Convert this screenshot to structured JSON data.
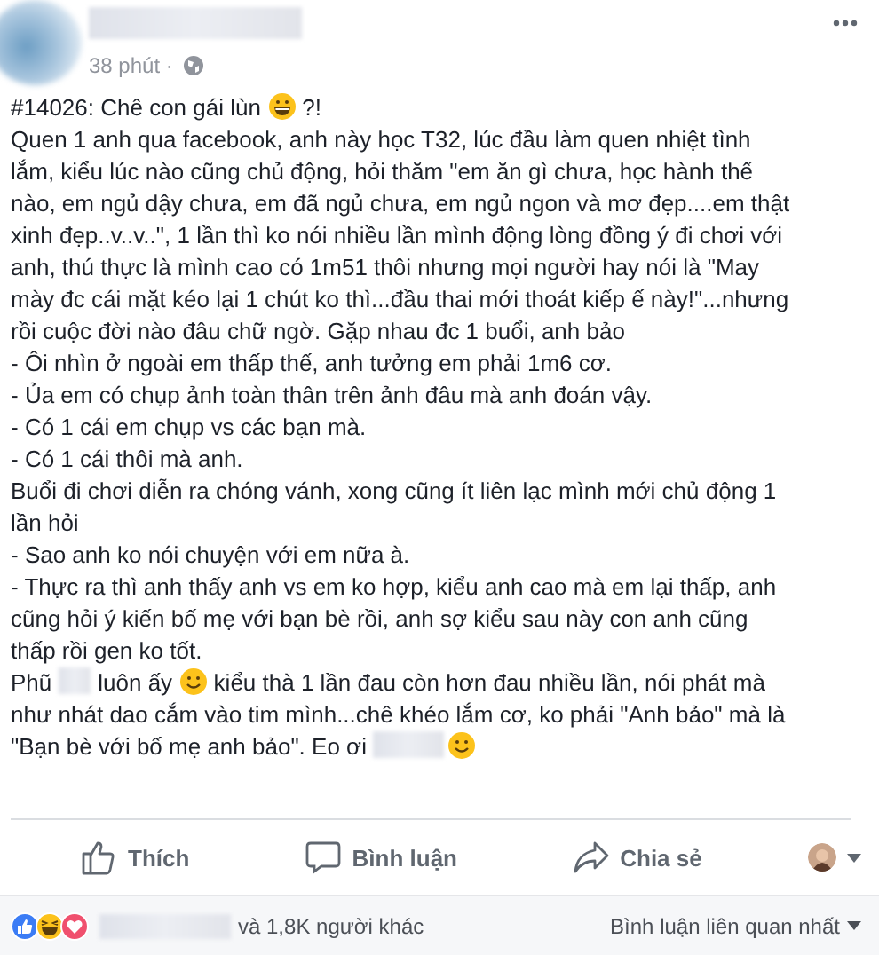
{
  "post": {
    "time": "38 phút",
    "separator": "·",
    "lines": [
      [
        {
          "kind": "text",
          "text": "#14026: Chê con gái lùn "
        },
        {
          "kind": "grin-emoji"
        },
        {
          "kind": "text",
          "text": " ?!"
        }
      ],
      [
        {
          "kind": "text",
          "text": "Quen 1 anh qua facebook, anh này học T32, lúc đầu làm quen nhiệt tình"
        }
      ],
      [
        {
          "kind": "text",
          "text": "lắm, kiểu lúc nào cũng chủ động, hỏi thăm \"em ăn gì chưa, học hành thế"
        }
      ],
      [
        {
          "kind": "text",
          "text": "nào, em ngủ dậy chưa, em đã ngủ chưa, em ngủ ngon và mơ đẹp....em thật"
        }
      ],
      [
        {
          "kind": "text",
          "text": "xinh đẹp..v..v..\", 1 lần thì ko nói nhiều lần mình động lòng đồng ý đi chơi với"
        }
      ],
      [
        {
          "kind": "text",
          "text": "anh, thú thực là mình cao có 1m51 thôi nhưng mọi người hay nói là \"May"
        }
      ],
      [
        {
          "kind": "text",
          "text": "mày đc cái mặt kéo lại 1 chút ko thì...đầu thai mới thoát kiếp ế này!\"...nhưng"
        }
      ],
      [
        {
          "kind": "text",
          "text": "rồi cuộc đời nào đâu chữ ngờ. Gặp nhau đc 1 buổi, anh bảo"
        }
      ],
      [
        {
          "kind": "text",
          "text": "- Ôi nhìn ở ngoài em thấp thế, anh tưởng em phải 1m6 cơ."
        }
      ],
      [
        {
          "kind": "text",
          "text": "- Ủa em có chụp ảnh toàn thân trên ảnh đâu mà anh đoán vậy."
        }
      ],
      [
        {
          "kind": "text",
          "text": "- Có 1 cái em chụp vs các bạn mà."
        }
      ],
      [
        {
          "kind": "text",
          "text": "- Có 1 cái thôi mà anh."
        }
      ],
      [
        {
          "kind": "text",
          "text": "Buổi đi chơi diễn ra chóng vánh, xong cũng ít liên lạc mình mới chủ động 1"
        }
      ],
      [
        {
          "kind": "text",
          "text": "lần hỏi"
        }
      ],
      [
        {
          "kind": "text",
          "text": "- Sao anh ko nói chuyện với em nữa à."
        }
      ],
      [
        {
          "kind": "text",
          "text": "- Thực ra thì anh thấy anh vs em ko hợp, kiểu anh cao mà em lại thấp, anh"
        }
      ],
      [
        {
          "kind": "text",
          "text": "cũng hỏi ý kiến bố mẹ với bạn bè rồi, anh sợ kiểu sau này con anh cũng"
        }
      ],
      [
        {
          "kind": "text",
          "text": "thấp rồi gen ko tốt."
        }
      ],
      [
        {
          "kind": "text",
          "text": "Phũ"
        },
        {
          "kind": "blur"
        },
        {
          "kind": "text",
          "text": "luôn ấy "
        },
        {
          "kind": "smile-emoji"
        },
        {
          "kind": "text",
          "text": " kiểu thà 1 lần đau còn hơn đau nhiều lần, nói phát mà"
        }
      ],
      [
        {
          "kind": "text",
          "text": "như nhát dao cắm vào tim mình...chê khéo lắm cơ, ko phải \"Anh bảo\" mà là"
        }
      ],
      [
        {
          "kind": "text",
          "text": "\"Bạn bè với bố mẹ anh bảo\". Eo ơi"
        },
        {
          "kind": "blur"
        },
        {
          "kind": "smile-emoji"
        }
      ]
    ]
  },
  "actions": [
    {
      "kind": "like",
      "label": "Thích"
    },
    {
      "kind": "comment",
      "label": "Bình luận"
    },
    {
      "kind": "share",
      "label": "Chia sẻ"
    }
  ],
  "reactions": {
    "types": [
      {
        "kind": "like"
      },
      {
        "kind": "haha"
      },
      {
        "kind": "love"
      }
    ],
    "others": "và 1,8K người khác",
    "sort": "Bình luận liên quan nhất"
  }
}
